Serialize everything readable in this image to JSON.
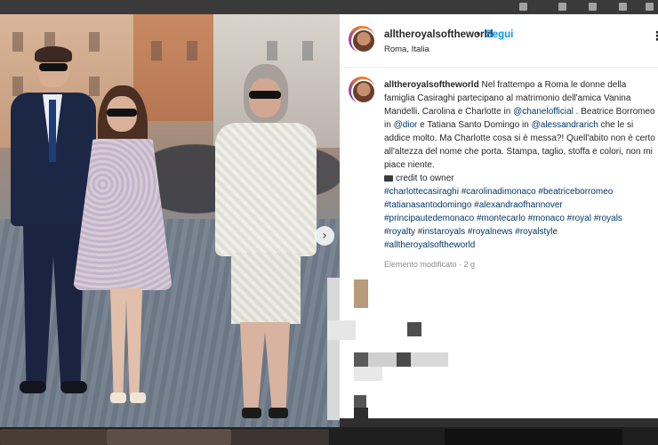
{
  "post": {
    "header": {
      "username": "alltheroyalsoftheworld",
      "separator": "•",
      "follow_label": "Segui",
      "location": "Roma, Italia",
      "more_icon": "more-dots-icon"
    },
    "caption": {
      "username": "alltheroyalsoftheworld",
      "text_1": " Nel frattempo a Roma le donne della famiglia Casiraghi partecipano al matrimonio dell'amica Vanina Mandelli. Carolina e Charlotte in ",
      "mention_1": "@chanelofficial",
      "text_2": " . Beatrice Borromeo in ",
      "mention_2": "@dior",
      "text_3": " e Tatiana Santo Domingo in ",
      "mention_3": "@alessandrarich",
      "text_4": " che le si addice molto. Ma Charlotte cosa si è messa?! Quell'abito non è certo all'altezza del nome che porta. Stampa, taglio, stoffa e colori, non mi piace niente.",
      "credit": "credit to owner",
      "hashtags_line_1": "#charlottecasiraghi #carolinadimonaco #beatriceborromeo",
      "hashtags_line_2": "#tatianasantodomingo #alexandraofhannover",
      "hashtags_line_3": "#principautedemonaco #montecarlo #monaco #royal #royals",
      "hashtags_line_4": "#royalty #instaroyals #royalnews #royalstyle",
      "hashtags_line_5": "#alltheroyalsoftheworld"
    },
    "meta": "Elemento modificato · 2 g"
  },
  "carousel": {
    "next_icon": "chevron-right-icon",
    "next_glyph": "›"
  },
  "colors": {
    "follow_blue": "#0095f6",
    "link_navy": "#00376b",
    "text": "#262626",
    "muted": "#8e8e8e"
  }
}
